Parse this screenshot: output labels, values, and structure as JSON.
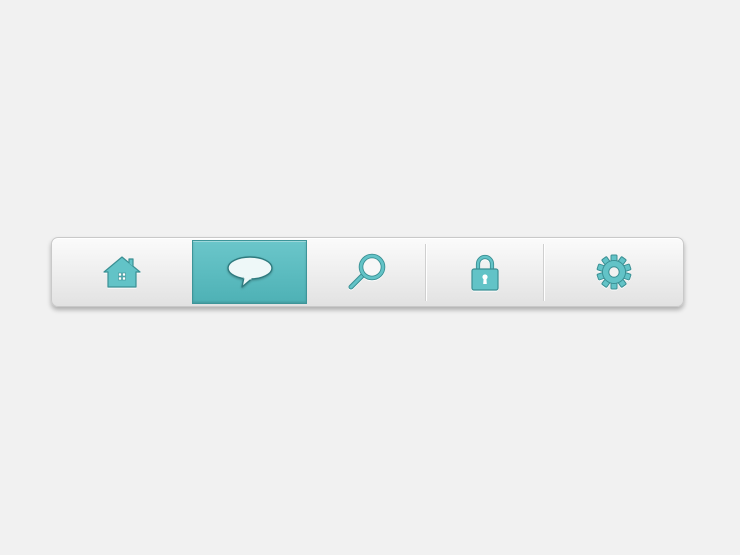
{
  "toolbar": {
    "tabs": [
      {
        "id": "home",
        "icon": "home-icon",
        "active": false
      },
      {
        "id": "chat",
        "icon": "speech-bubble-icon",
        "active": true
      },
      {
        "id": "search",
        "icon": "search-icon",
        "active": false
      },
      {
        "id": "lock",
        "icon": "lock-icon",
        "active": false
      },
      {
        "id": "settings",
        "icon": "gear-icon",
        "active": false
      }
    ]
  },
  "colors": {
    "accent": "#5cbcc0",
    "icon": "#62c3c7",
    "icon_stroke": "#3a8f93",
    "background": "#f1f1f1"
  }
}
